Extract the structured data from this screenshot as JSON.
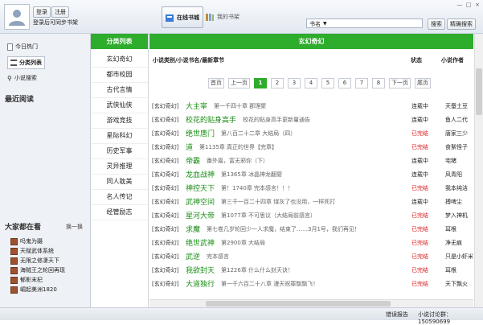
{
  "user": {
    "login_label": "登录",
    "register_label": "注册",
    "login_tip": "登录后可同步书架"
  },
  "tabs": [
    {
      "label": "在线书城"
    },
    {
      "label": "我的书架"
    }
  ],
  "window": {
    "min": "—",
    "max": "□",
    "close": "×"
  },
  "search": {
    "type_label": "书名",
    "search_label": "搜索",
    "precise_label": "精确搜索"
  },
  "leftnav": {
    "items": [
      {
        "label": "今日热门"
      },
      {
        "label": "分类列表"
      },
      {
        "label": "小说搜索"
      }
    ],
    "recent_title": "最近阅读",
    "hot_title": "大家都在看",
    "refresh_label": "换一换",
    "hot": [
      "吗鬼为蹑",
      "天赋武体系统",
      "无限之修凄天下",
      "海贼王之轮回再现",
      "郁影末杞",
      "崛起美洲1820"
    ]
  },
  "categories": {
    "header": "分类列表",
    "items": [
      "玄幻奇幻",
      "都市校园",
      "古代言情",
      "武侠仙侠",
      "游戏竞技",
      "星际科幻",
      "历史军事",
      "灵异推理",
      "同人耽美",
      "名人传记",
      "经管励志"
    ]
  },
  "main": {
    "header": "玄幻奇幻",
    "col_title": "小说类别/小说书名/最新章节",
    "col_status": "状态",
    "col_author": "小说作者",
    "pager": {
      "first": "首页",
      "prev": "上一页",
      "pages": [
        "1",
        "2",
        "3",
        "4",
        "5",
        "6",
        "7",
        "8"
      ],
      "current": "1",
      "next": "下一页",
      "last": "尾页"
    },
    "rows": [
      {
        "cat": "[玄幻奇幻]",
        "title": "大主宰",
        "chapter": "第一千四十章 郡理聚",
        "status": "连载中",
        "author": "天蚕土豆"
      },
      {
        "cat": "[玄幻奇幻]",
        "title": "校花的贴身高手",
        "chapter": "校花的贴身高手更新量通告",
        "status": "连载中",
        "author": "鱼人二代"
      },
      {
        "cat": "[玄幻奇幻]",
        "title": "绝世唐门",
        "chapter": "第八百二十二章 大结局（四）",
        "status": "已完结",
        "author": "唐家三少"
      },
      {
        "cat": "[玄幻奇幻]",
        "title": "道",
        "chapter": "第1135章 真正的世界【完章】",
        "status": "已完结",
        "author": "食絮怪子"
      },
      {
        "cat": "[玄幻奇幻]",
        "title": "帝霸",
        "chapter": "番外篇，富无邪你（下）",
        "status": "连载中",
        "author": "宅猪"
      },
      {
        "cat": "[玄幻奇幻]",
        "title": "龙血战神",
        "chapter": "第1365章 冰晶神龙翻婴",
        "status": "连载中",
        "author": "风青阳"
      },
      {
        "cat": "[玄幻奇幻]",
        "title": "神控天下",
        "chapter": "第！1740章 完本感言！！！",
        "status": "已完结",
        "author": "我本纯洁"
      },
      {
        "cat": "[玄幻奇幻]",
        "title": "武神空间",
        "chapter": "第三千一百二十四章 煤灰了也没用，一样死打",
        "status": "连载中",
        "author": "搏啤尘"
      },
      {
        "cat": "[玄幻奇幻]",
        "title": "星河大帝",
        "chapter": "第1077章 不可思议（大结局前感言）",
        "status": "已完结",
        "author": "梦入神机"
      },
      {
        "cat": "[玄幻奇幻]",
        "title": "求魔",
        "chapter": "第七卷几岁轮回少一人求魔，结束了……3月1号，我们再见！",
        "status": "已完结",
        "author": "耳根"
      },
      {
        "cat": "[玄幻奇幻]",
        "title": "绝世武神",
        "chapter": "第2900章 大结局",
        "status": "已完结",
        "author": "净无痕"
      },
      {
        "cat": "[玄幻奇幻]",
        "title": "武逆",
        "chapter": "完本感言",
        "status": "已完结",
        "author": "只是小虾米"
      },
      {
        "cat": "[玄幻奇幻]",
        "title": "我欲封天",
        "chapter": "第1226章 什么什么封天诀！",
        "status": "已完结",
        "author": "耳根"
      },
      {
        "cat": "[玄幻奇幻]",
        "title": "大道独行",
        "chapter": "第一千六百二十八章 漫天祝罪飘飘飞！",
        "status": "已完结",
        "author": "天下飘火"
      }
    ]
  },
  "statusbar": {
    "report": "错误报告",
    "forum": "小说讨论群：150590699"
  },
  "colors": {
    "accent": "#2eac2c",
    "completed": "#e02020",
    "title_green": "#1a8d16"
  }
}
